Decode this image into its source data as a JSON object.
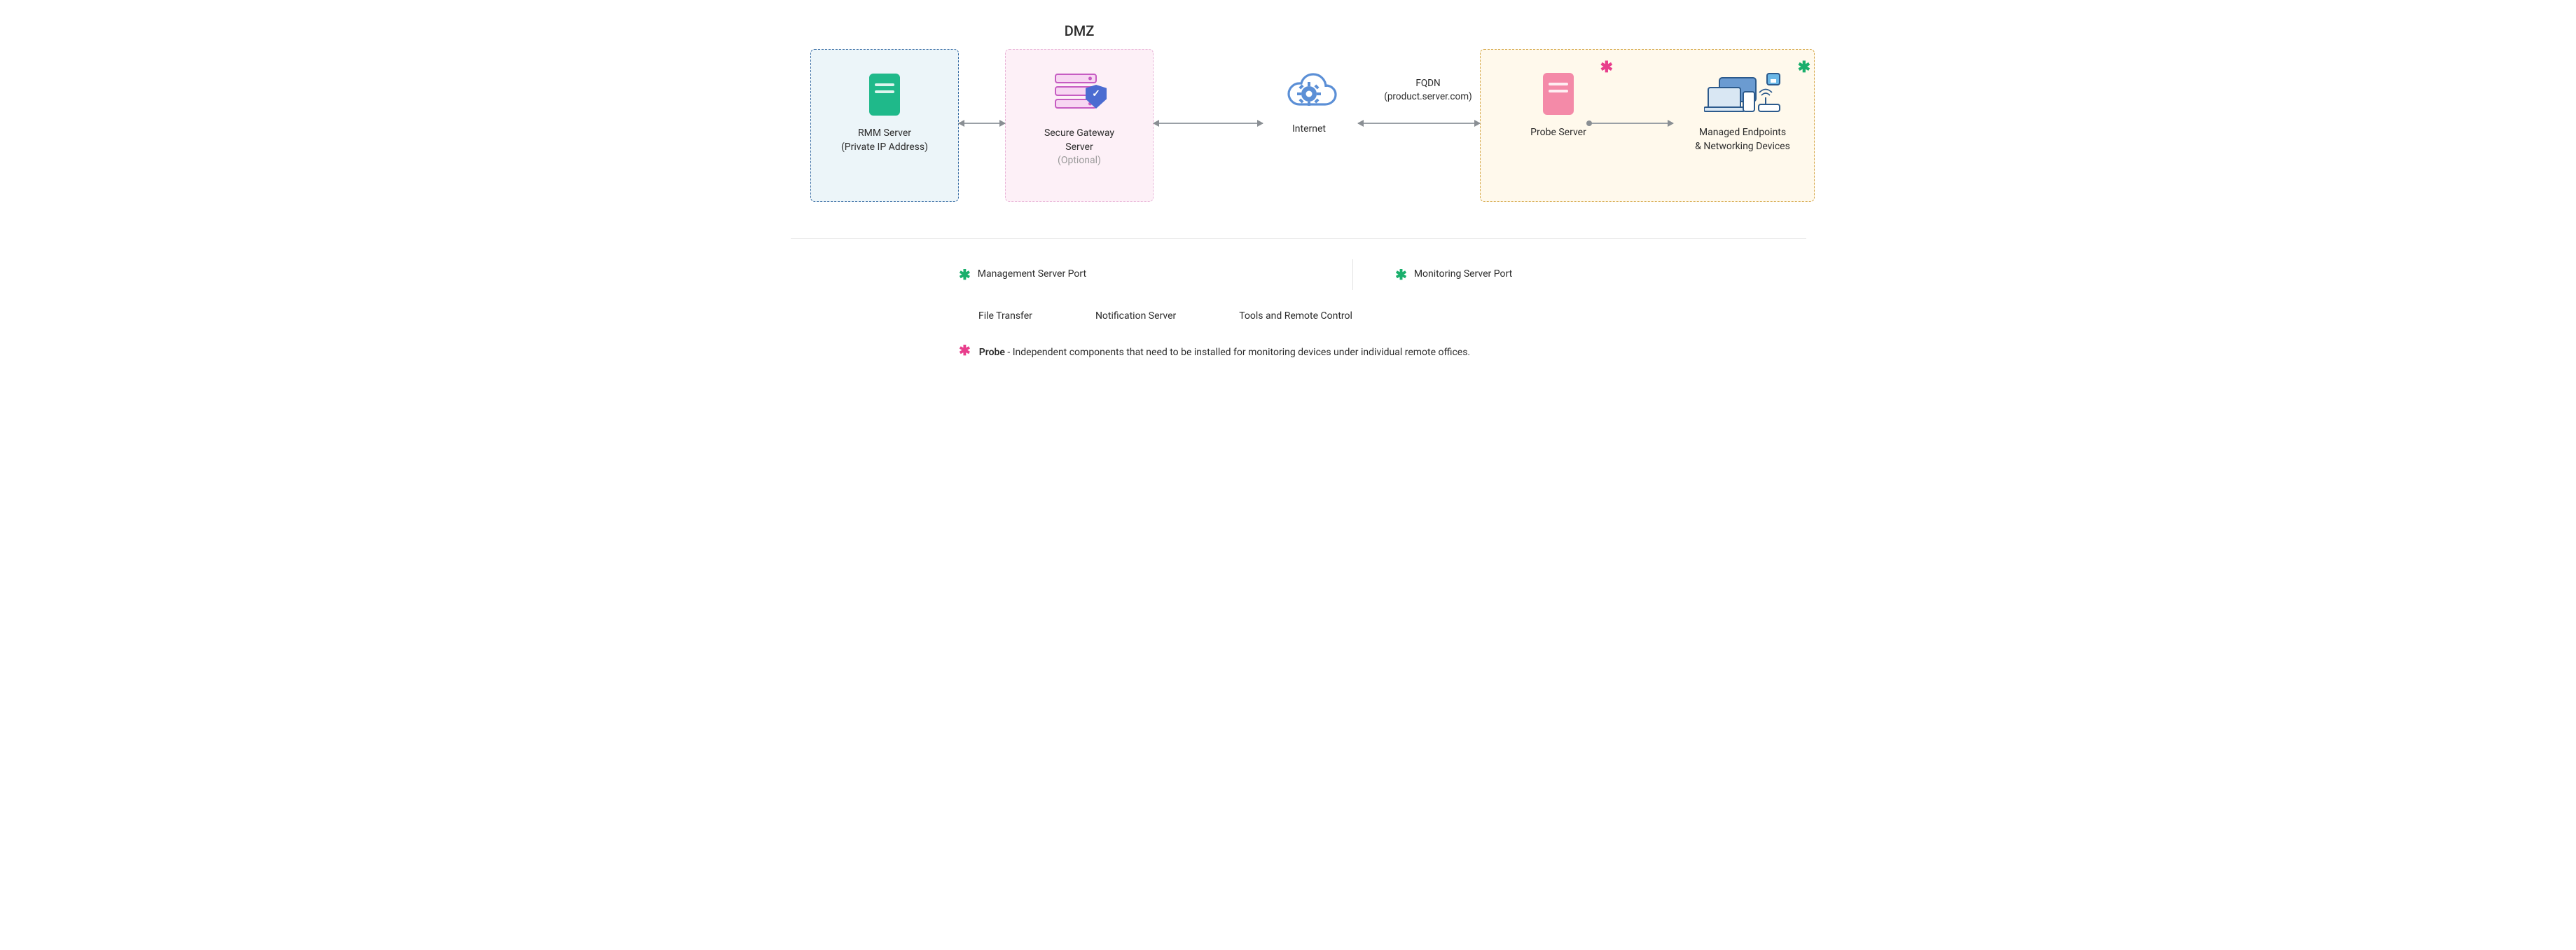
{
  "zones": {
    "dmz_title": "DMZ",
    "rmm": {
      "label_line1": "RMM Server",
      "label_line2": "(Private IP Address)"
    },
    "sgs": {
      "label_line1": "Secure Gateway",
      "label_line2": "Server",
      "optional": "(Optional)"
    },
    "internet": {
      "label": "Internet"
    },
    "fqdn": {
      "line1": "FQDN",
      "line2": "(product.server.com)"
    },
    "probe": {
      "label": "Probe Server"
    },
    "devices": {
      "label_line1": "Managed Endpoints",
      "label_line2": "& Networking Devices"
    }
  },
  "legend": {
    "management_port": "Management Server Port",
    "monitoring_port": "Monitoring Server Port",
    "file_transfer": "File Transfer",
    "notification_server": "Notification Server",
    "tools_remote": "Tools and Remote Control",
    "probe_note_label": "Probe",
    "probe_note_text": " - Independent components that need to be installed for monitoring devices under individual remote offices."
  },
  "colors": {
    "ast_pink": "#e83e8c",
    "ast_green": "#1aaf6c",
    "arrow": "#9aa0a6"
  }
}
